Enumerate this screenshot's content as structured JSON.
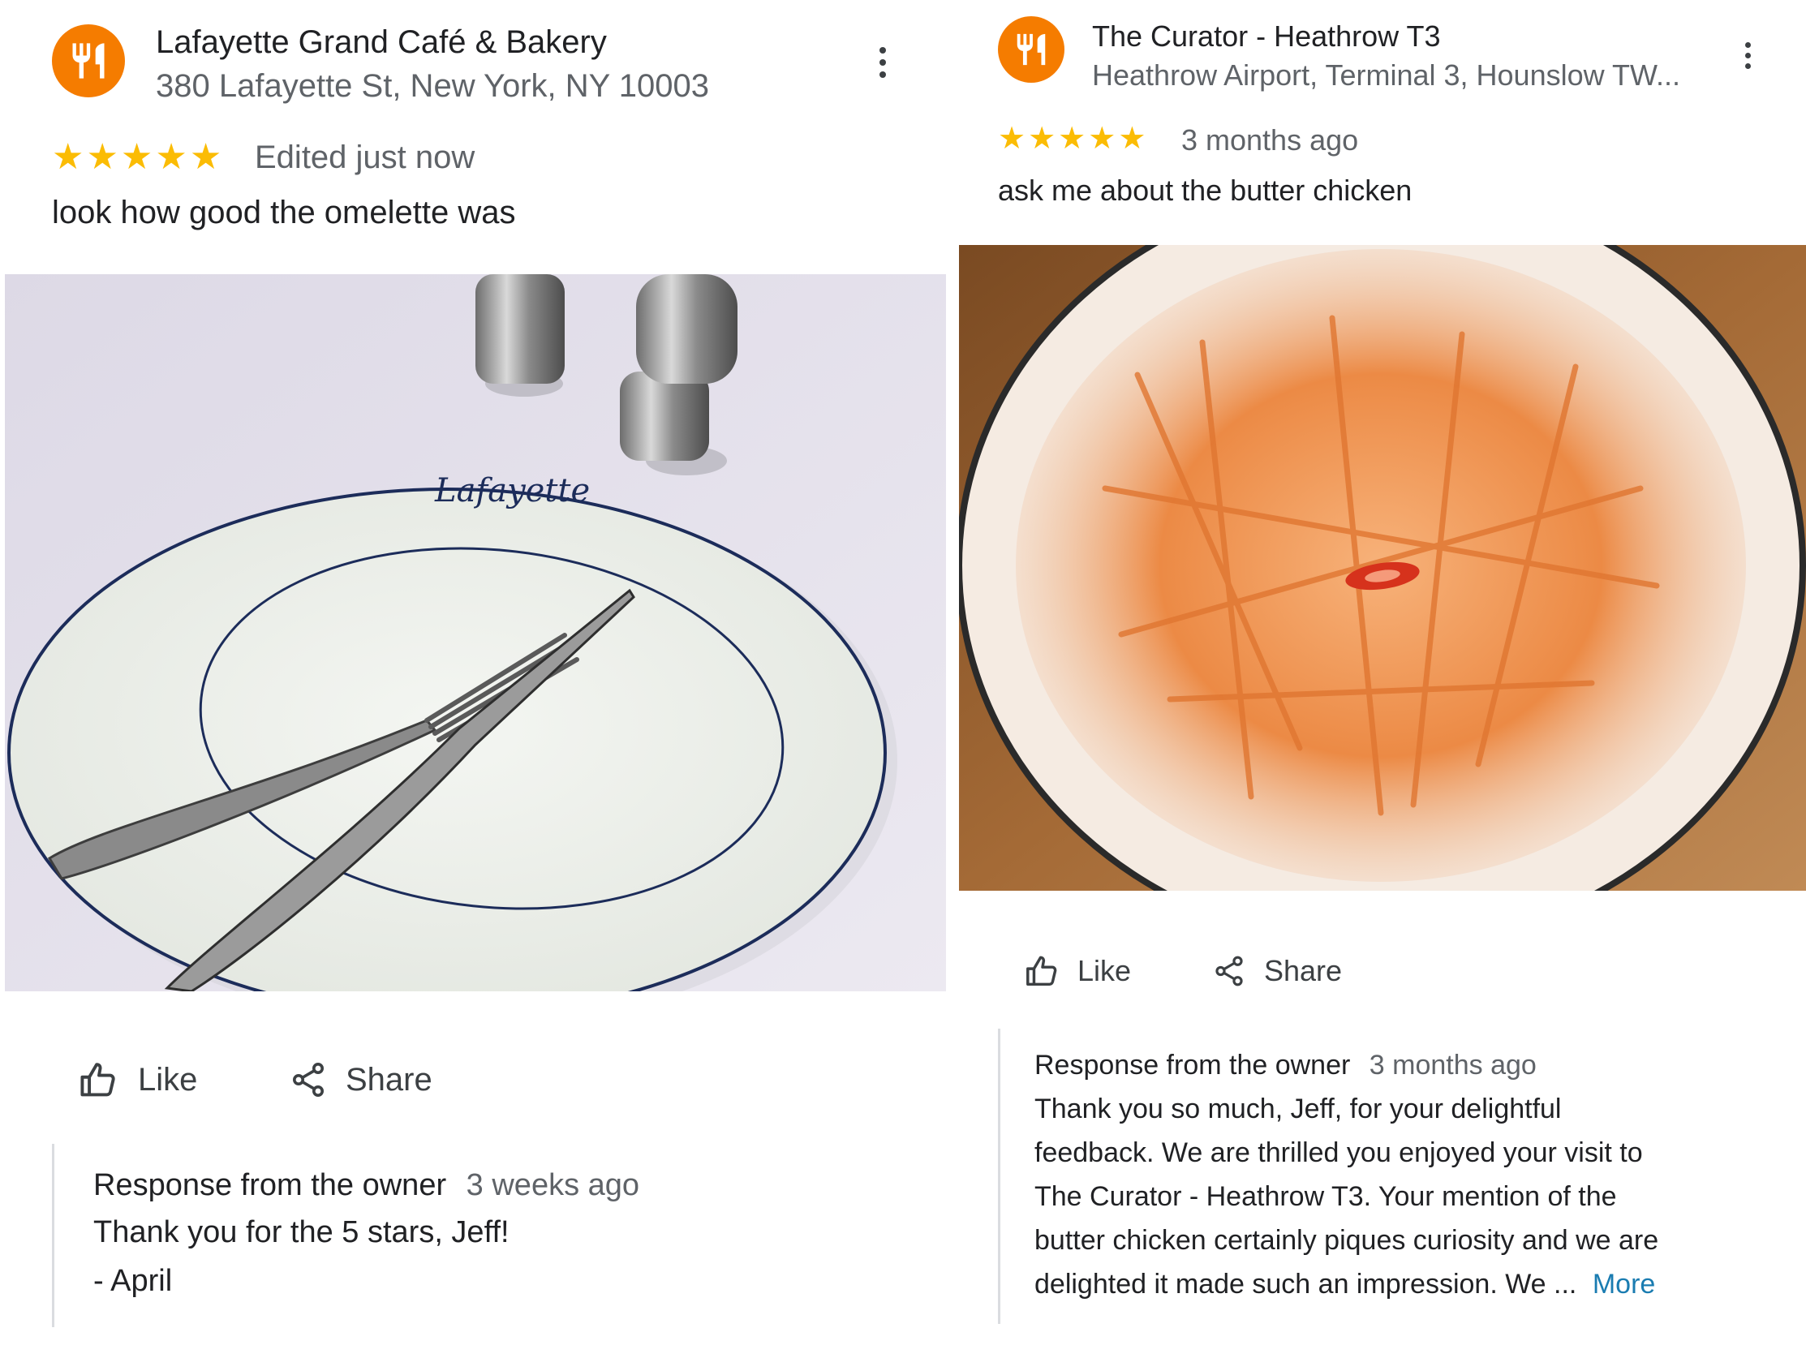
{
  "colors": {
    "accent_orange": "#f57c00",
    "star_yellow": "#fbbc04",
    "secondary_text": "#5f6368",
    "link_blue": "#1a7cb1"
  },
  "reviews": [
    {
      "place_name": "Lafayette Grand Café & Bakery",
      "place_address": "380 Lafayette St, New York, NY 10003",
      "place_icon": "restaurant-icon",
      "rating": 5,
      "stars": [
        "★",
        "★",
        "★",
        "★",
        "★"
      ],
      "time": "Edited just now",
      "text": "look how good the omelette was",
      "photo_desc": "empty oval Lafayette plate with fork and knife",
      "plate_logo": "Lafayette",
      "like_label": "Like",
      "share_label": "Share",
      "owner_response": {
        "title": "Response from the owner",
        "time": "3 weeks ago",
        "lines": [
          "Thank you for the 5 stars, Jeff!",
          "- April"
        ]
      }
    },
    {
      "place_name": "The Curator - Heathrow T3",
      "place_address": "Heathrow Airport, Terminal 3, Hounslow TW...",
      "place_icon": "restaurant-icon",
      "rating": 5,
      "stars": [
        "★",
        "★",
        "★",
        "★",
        "★"
      ],
      "time": "3 months ago",
      "text": "ask me about the butter chicken",
      "photo_desc": "empty plate smeared with butter chicken sauce",
      "like_label": "Like",
      "share_label": "Share",
      "owner_response": {
        "title": "Response from the owner",
        "time": "3 months ago",
        "lines": [
          "Thank you so much, Jeff, for your delightful",
          "feedback. We are thrilled you enjoyed your visit to",
          "The Curator - Heathrow T3. Your mention of the",
          "butter chicken certainly piques curiosity and we are",
          "delighted it made such an impression. We ..."
        ],
        "more_label": "More"
      }
    }
  ]
}
